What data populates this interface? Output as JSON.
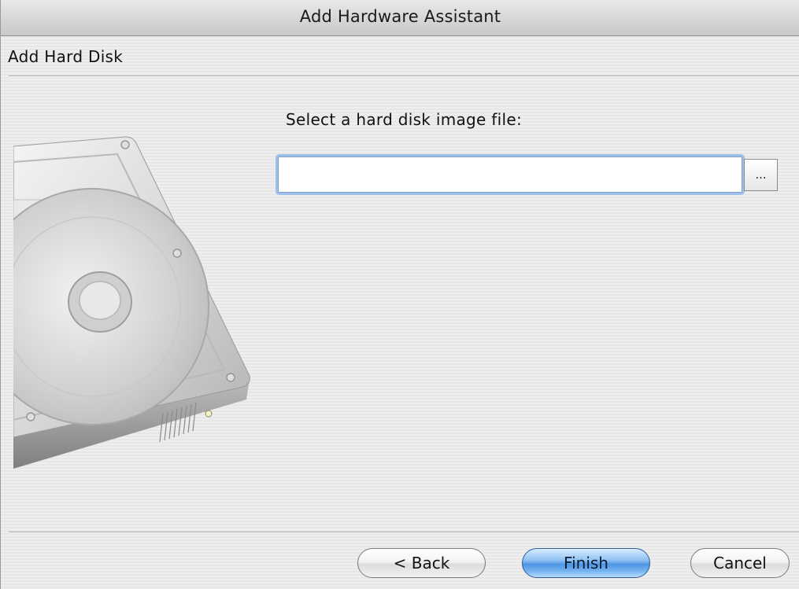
{
  "window": {
    "title": "Add Hardware Assistant"
  },
  "page": {
    "heading": "Add Hard Disk",
    "prompt": "Select a hard disk image file:"
  },
  "file_field": {
    "value": "",
    "browse_label": "..."
  },
  "buttons": {
    "back_label": "< Back",
    "finish_label": "Finish",
    "cancel_label": "Cancel"
  },
  "icons": {
    "artwork": "hard-disk-icon"
  },
  "colors": {
    "default_button": "#4e95e3",
    "focus_ring": "#9fc0ea"
  }
}
